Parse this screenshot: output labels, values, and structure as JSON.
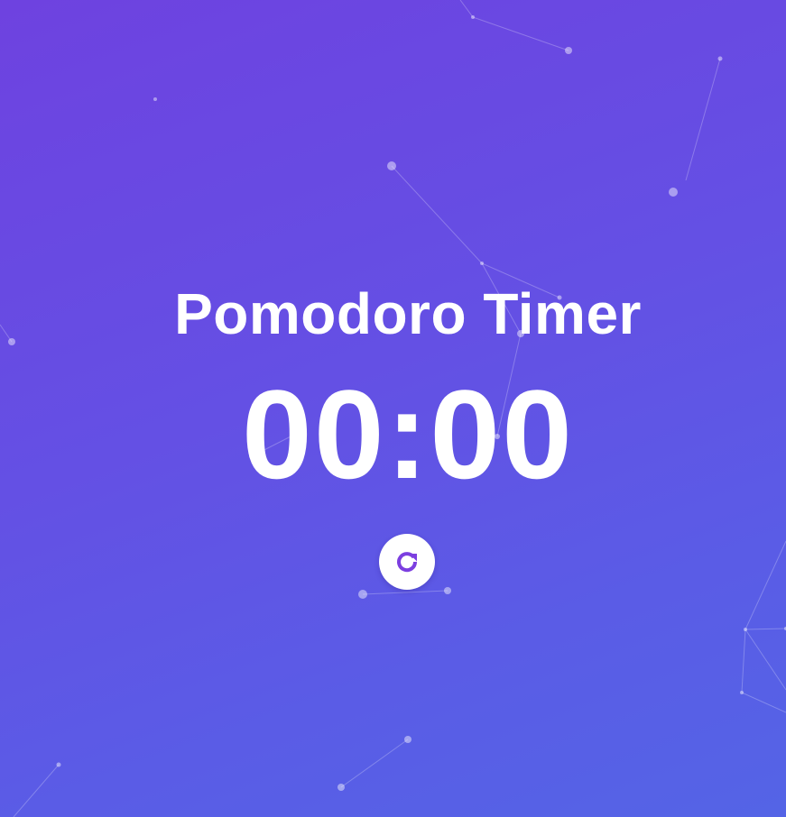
{
  "app": {
    "title": "Pomodoro Timer"
  },
  "timer": {
    "display": "00:00"
  },
  "controls": {
    "reset_icon": "reset-icon"
  },
  "colors": {
    "background_start": "#6e42e0",
    "background_end": "#5464e6",
    "text": "#ffffff",
    "button_bg": "#ffffff",
    "icon": "#7c3fe0"
  }
}
